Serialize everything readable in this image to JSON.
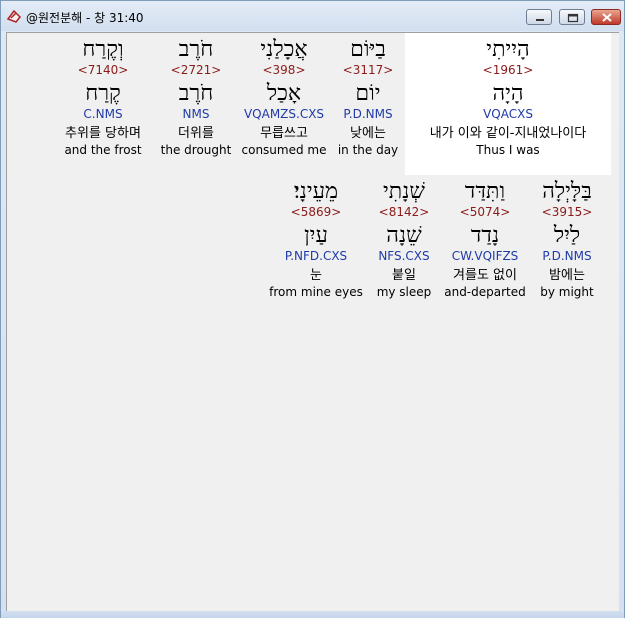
{
  "window": {
    "title": "@원전분해 - 창 31:40",
    "buttons": {
      "minimize": "minimize",
      "maximize": "maximize",
      "close": "close"
    },
    "accent": "#c0392b"
  },
  "row1": [
    {
      "hebrew": "הָיִיתִי",
      "strong": "<1961>",
      "lemma": "הָיָה",
      "parse": "VQACXS",
      "korean": "내가 이와 같이-지내었나이다",
      "english": "Thus I was",
      "selected": true
    },
    {
      "hebrew": "בַיּוֹם",
      "strong": "<3117>",
      "lemma": "יוֹם",
      "parse": "P.D.NMS",
      "korean": "낮에는",
      "english": "in the day"
    },
    {
      "hebrew": "אֲכָלַנִי",
      "strong": "<398>",
      "lemma": "אָכַל",
      "parse": "VQAMZS.CXS",
      "korean": "무릅쓰고",
      "english": "consumed me"
    },
    {
      "hebrew": "חֹרֶב",
      "strong": "<2721>",
      "lemma": "חֹרֶב",
      "parse": "NMS",
      "korean": "더위를",
      "english": "the drought"
    },
    {
      "hebrew": "וְקֶרַח",
      "strong": "<7140>",
      "lemma": "קֶרַח",
      "parse": "C.NMS",
      "korean": "추위를 당하며",
      "english": "and the frost"
    }
  ],
  "row2": [
    {
      "hebrew": "בַּלָּיְלָה",
      "strong": "<3915>",
      "lemma": "לַיִל",
      "parse": "P.D.NMS",
      "korean": "밤에는",
      "english": "by might"
    },
    {
      "hebrew": "וַתִּדַּד",
      "strong": "<5074>",
      "lemma": "נָדַד",
      "parse": "CW.VQIFZS",
      "korean": "겨를도 없이",
      "english": "and-departed"
    },
    {
      "hebrew": "שְׁנָתִי",
      "strong": "<8142>",
      "lemma": "שֵׁנָה",
      "parse": "NFS.CXS",
      "korean": "붙일",
      "english": "my sleep"
    },
    {
      "hebrew": "מֵעֵינָי׃",
      "strong": "<5869>",
      "lemma": "עַיִן",
      "parse": "P.NFD.CXS",
      "korean": "눈",
      "english": "from mine eyes"
    }
  ]
}
